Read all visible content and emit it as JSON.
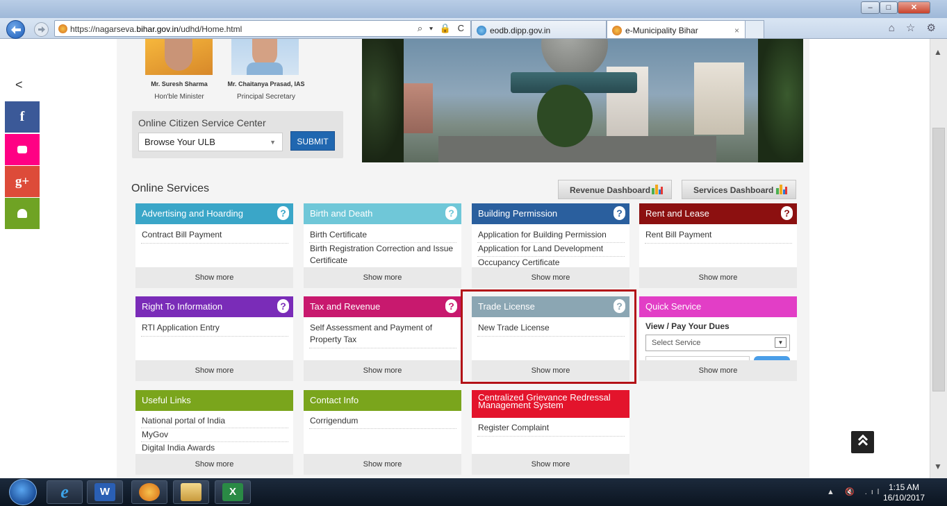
{
  "browser": {
    "url_prefix": "https://nagarseva.",
    "url_domain": "bihar.gov.in",
    "url_path": "/udhd/Home.html",
    "address_icons": "⌕ ▾ 🔒 C",
    "tabs": [
      {
        "title": "eodb.dipp.gov.in",
        "active": false
      },
      {
        "title": "e-Municipality Bihar",
        "active": true
      }
    ],
    "tab_close": "×",
    "window_buttons": {
      "minimize": "–",
      "maximize": "□",
      "close": "✕"
    },
    "tools": "⌂ ☆ ⚙"
  },
  "social": {
    "toggle": "<",
    "facebook": "f",
    "googleplus": "g+"
  },
  "officials": [
    {
      "name": "Mr. Suresh Sharma",
      "role": "Hon'ble Minister"
    },
    {
      "name": "Mr. Chaitanya Prasad, IAS",
      "role": "Principal Secretary"
    }
  ],
  "citizen_center": {
    "title": "Online Citizen Service Center",
    "select_value": "Browse Your ULB",
    "submit": "SUBMIT"
  },
  "services": {
    "title": "Online Services",
    "revenue_dashboard": "Revenue Dashboard",
    "services_dashboard": "Services Dashboard",
    "help_glyph": "?",
    "show_more": "Show more",
    "cards": {
      "advertising": {
        "title": "Advertising and Hoarding",
        "color": "#3aa6c8",
        "items": [
          "Contract Bill Payment"
        ]
      },
      "birth": {
        "title": "Birth and Death",
        "color": "#6fc7d8",
        "items": [
          "Birth Certificate",
          "Birth Registration Correction and Issue Certificate"
        ]
      },
      "building": {
        "title": "Building Permission",
        "color": "#2a5f9e",
        "items": [
          "Application for Building Permission",
          "Application for Land Development",
          "Occupancy Certificate"
        ]
      },
      "rent": {
        "title": "Rent and Lease",
        "color": "#8c1010",
        "items": [
          "Rent Bill Payment"
        ]
      },
      "rti": {
        "title": "Right To Information",
        "color": "#7a2cb8",
        "items": [
          "RTI Application Entry"
        ]
      },
      "tax": {
        "title": "Tax and Revenue",
        "color": "#c8196e",
        "items": [
          "Self Assessment and Payment of Property Tax"
        ]
      },
      "trade": {
        "title": "Trade License",
        "color": "#8ba6b3",
        "items": [
          "New Trade License"
        ]
      },
      "quick": {
        "title": "Quick Service",
        "color": "#e23ec6",
        "label": "View / Pay Your Dues",
        "select": "Select Service"
      },
      "links": {
        "title": "Useful Links",
        "color": "#7aa51c",
        "items": [
          "National portal of India",
          "MyGov",
          "Digital India Awards"
        ]
      },
      "contact": {
        "title": "Contact Info",
        "color": "#7aa51c",
        "items": [
          "Corrigendum"
        ]
      },
      "grievance": {
        "title": "Centralized Grievance Redressal Management System",
        "color": "#e3142c",
        "items": [
          "Register Complaint"
        ]
      }
    }
  },
  "to_top": "⌃",
  "taskbar": {
    "word": "W",
    "excel": "X",
    "ie": "e",
    "tray_icons": "▲ 🔇 .ıl",
    "time": "1:15 AM",
    "date": "16/10/2017"
  }
}
